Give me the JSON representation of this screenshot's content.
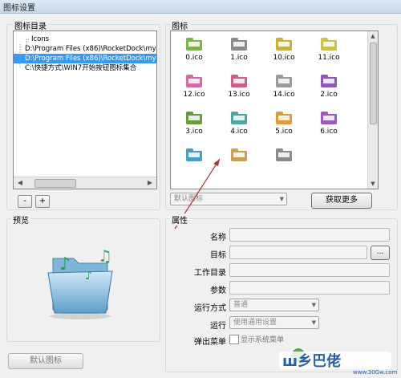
{
  "window": {
    "title": "图标设置"
  },
  "dir_panel": {
    "label": "图标目录",
    "tree": [
      {
        "text": "Icons",
        "indent": 1,
        "selected": false
      },
      {
        "text": "D:\\Program Files (x86)\\RocketDock\\my",
        "indent": 0,
        "selected": false
      },
      {
        "text": "D:\\Program Files (x86)\\RocketDock\\my",
        "indent": 0,
        "selected": true
      },
      {
        "text": "C:\\快捷方式\\WIN7开始按钮图标集合",
        "indent": 0,
        "selected": false
      }
    ],
    "minus_label": "-",
    "plus_label": "+"
  },
  "icon_panel": {
    "label": "图标",
    "icons": [
      {
        "name": "0.ico",
        "color": "#7fb24a"
      },
      {
        "name": "1.ico",
        "color": "#8a8a8a"
      },
      {
        "name": "10.ico",
        "color": "#c6b23a"
      },
      {
        "name": "11.ico",
        "color": "#c9c34b"
      },
      {
        "name": "12.ico",
        "color": "#d66aa6"
      },
      {
        "name": "13.ico",
        "color": "#c9608a"
      },
      {
        "name": "14.ico",
        "color": "#9b9b9b"
      },
      {
        "name": "2.ico",
        "color": "#8a5ab8"
      },
      {
        "name": "3.ico",
        "color": "#6a9a3a"
      },
      {
        "name": "4.ico",
        "color": "#4ca7a0"
      },
      {
        "name": "5.ico",
        "color": "#e29a34"
      },
      {
        "name": "6.ico",
        "color": "#9a5cc0"
      },
      {
        "name": "",
        "color": "#4a9cc4"
      },
      {
        "name": "",
        "color": "#c9a05a"
      },
      {
        "name": "",
        "color": "#8a8a8a"
      }
    ],
    "default_combo": "默认图标",
    "get_more_label": "获取更多"
  },
  "preview_panel": {
    "label": "预览"
  },
  "props_panel": {
    "label": "属性",
    "name_label": "名称",
    "target_label": "目标",
    "workdir_label": "工作目录",
    "params_label": "参数",
    "runmode_label": "运行方式",
    "runmode_value": "普通",
    "run_label": "运行",
    "run_value": "使用通用设置",
    "popup_label": "弹出菜单",
    "popup_check_label": "显示系统菜单",
    "browse_label": "..."
  },
  "footer": {
    "default_icon_button": "默认图标"
  },
  "watermark": {
    "text": "ш乡巴佬",
    "url": "www.30Gw.com"
  }
}
